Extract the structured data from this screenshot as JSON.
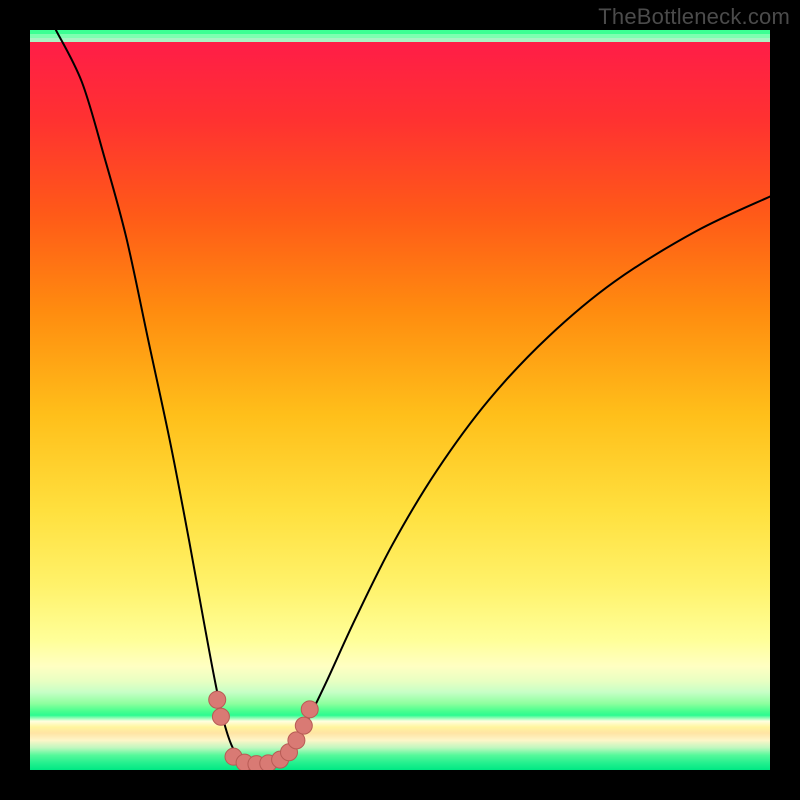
{
  "watermark": "TheBottleneck.com",
  "colors": {
    "frame": "#000000",
    "curve_stroke": "#000000",
    "marker_fill": "#d97a74",
    "marker_stroke": "#b85b55"
  },
  "chart_data": {
    "type": "line",
    "title": "",
    "xlabel": "",
    "ylabel": "",
    "xlim": [
      0,
      1
    ],
    "ylim": [
      0,
      1
    ],
    "legend": false,
    "grid": false,
    "note": "Bottleneck-style V-curve on a vertical rainbow gradient. x and y are in normalized plot-area coordinates (0..1, y=0 at bottom). The y-axis is an unlabeled bottleneck-percentage-like quantity; the V-notch near x≈0.27–0.35 touches y≈0 and both arms rise steeply toward y≈1 at the edges.",
    "curve_points": [
      {
        "x": 0.035,
        "y": 1.0
      },
      {
        "x": 0.07,
        "y": 0.93
      },
      {
        "x": 0.1,
        "y": 0.83
      },
      {
        "x": 0.13,
        "y": 0.72
      },
      {
        "x": 0.16,
        "y": 0.58
      },
      {
        "x": 0.19,
        "y": 0.44
      },
      {
        "x": 0.215,
        "y": 0.31
      },
      {
        "x": 0.235,
        "y": 0.2
      },
      {
        "x": 0.25,
        "y": 0.12
      },
      {
        "x": 0.262,
        "y": 0.065
      },
      {
        "x": 0.275,
        "y": 0.028
      },
      {
        "x": 0.292,
        "y": 0.01
      },
      {
        "x": 0.315,
        "y": 0.008
      },
      {
        "x": 0.337,
        "y": 0.014
      },
      {
        "x": 0.355,
        "y": 0.032
      },
      {
        "x": 0.373,
        "y": 0.063
      },
      {
        "x": 0.4,
        "y": 0.118
      },
      {
        "x": 0.44,
        "y": 0.205
      },
      {
        "x": 0.49,
        "y": 0.305
      },
      {
        "x": 0.55,
        "y": 0.405
      },
      {
        "x": 0.62,
        "y": 0.5
      },
      {
        "x": 0.7,
        "y": 0.585
      },
      {
        "x": 0.79,
        "y": 0.66
      },
      {
        "x": 0.9,
        "y": 0.728
      },
      {
        "x": 1.0,
        "y": 0.775
      }
    ],
    "markers": [
      {
        "x": 0.253,
        "y": 0.095
      },
      {
        "x": 0.258,
        "y": 0.072
      },
      {
        "x": 0.275,
        "y": 0.018
      },
      {
        "x": 0.29,
        "y": 0.01
      },
      {
        "x": 0.306,
        "y": 0.008
      },
      {
        "x": 0.322,
        "y": 0.009
      },
      {
        "x": 0.338,
        "y": 0.014
      },
      {
        "x": 0.35,
        "y": 0.024
      },
      {
        "x": 0.36,
        "y": 0.04
      },
      {
        "x": 0.37,
        "y": 0.06
      },
      {
        "x": 0.378,
        "y": 0.082
      }
    ]
  }
}
